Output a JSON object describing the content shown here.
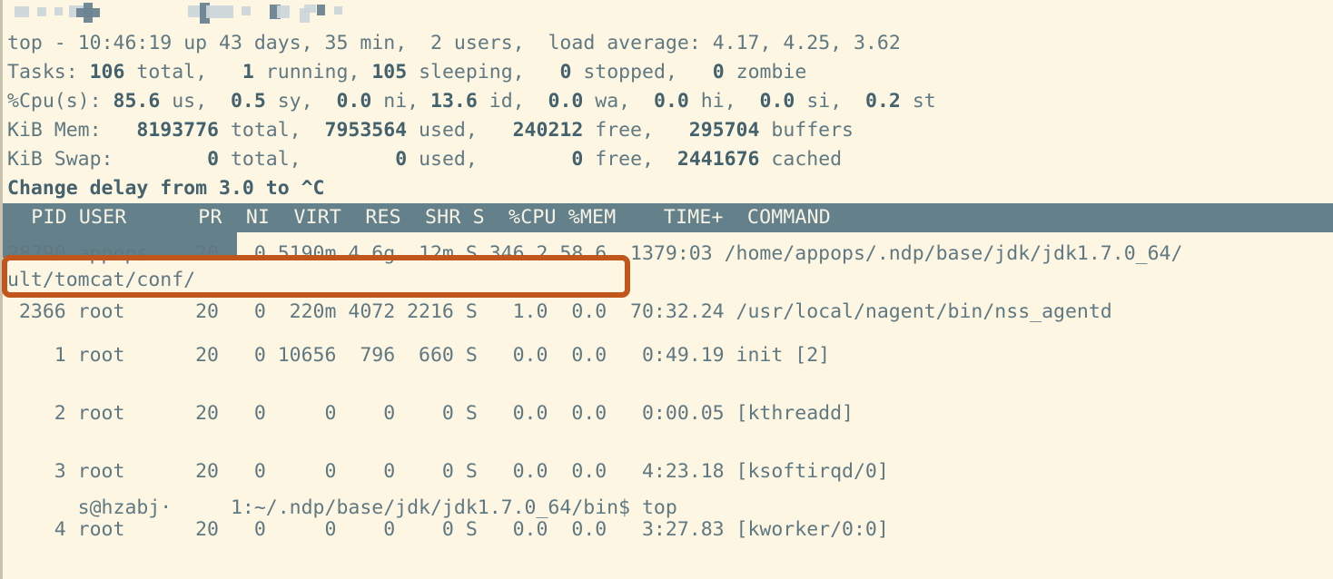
{
  "terminal": {
    "title": "top",
    "colors": {
      "background": "#fdf6e3",
      "foreground": "#5f7882",
      "bold": "#44626e",
      "header_bar_bg": "#64808b",
      "header_bar_fg": "#f7f3e4",
      "highlight_border": "#c0561b"
    }
  },
  "prompt": {
    "user_host_redacted": "s@hzabj·",
    "path_and_command": "1:~/.ndp/base/jdk/jdk1.7.0_64/bin$ top",
    "full_line": "s@hzabj·     1:~/.ndp/base/jdk/jdk1.7.0_64/bin$ top"
  },
  "summary": {
    "uptime_line": "top - 10:46:19 up 43 days, 35 min,  2 users,  load average: 4.17, 4.25, 3.62",
    "uptime": {
      "program": "top",
      "time": "10:46:19",
      "up": "43 days, 35 min",
      "users": "2 users",
      "load_average": "4.17, 4.25, 3.62"
    },
    "tasks_line": "Tasks: 106 total,   1 running, 105 sleeping,   0 stopped,   0 zombie",
    "tasks": {
      "total": "106",
      "running": "1",
      "sleeping": "105",
      "stopped": "0",
      "zombie": "0"
    },
    "cpu_line": "%Cpu(s): 85.6 us,  0.5 sy,  0.0 ni, 13.6 id,  0.0 wa,  0.0 hi,  0.0 si,  0.2 st",
    "cpu": {
      "us": "85.6",
      "sy": "0.5",
      "ni": "0.0",
      "id": "13.6",
      "wa": "0.0",
      "hi": "0.0",
      "si": "0.0",
      "st": "0.2"
    },
    "mem_line": "KiB Mem:   8193776 total,  7953564 used,   240212 free,   295704 buffers",
    "mem": {
      "total": "8193776",
      "used": "7953564",
      "free": "240212",
      "buffers": "295704"
    },
    "swap_line": "KiB Swap:        0 total,        0 used,        0 free,  2441676 cached",
    "swap": {
      "total": "0",
      "used": "0",
      "free": "0",
      "cached": "2441676"
    },
    "message_line": "Change delay from 3.0 to ^C",
    "message": {
      "text": "Change delay from 3.0 to ^C",
      "delay": "3.0",
      "new_value": "^C"
    }
  },
  "table": {
    "header_line": "  PID USER      PR  NI  VIRT  RES  SHR S  %CPU %MEM    TIME+  COMMAND",
    "columns": [
      "PID",
      "USER",
      "PR",
      "NI",
      "VIRT",
      "RES",
      "SHR",
      "S",
      "%CPU",
      "%MEM",
      "TIME+",
      "COMMAND"
    ],
    "rows": [
      {
        "line": "28790 appops    20   0 5190m 4.6g  12m S 346.2 58.6  1379:03 /home/appops/.ndp/base/jdk/jdk1.7.0_64/",
        "pid": "28790",
        "user": "appops",
        "pr": "20",
        "ni": "0",
        "virt": "5190m",
        "res": "4.6g",
        "shr": "12m",
        "s": "S",
        "cpu": "346.2",
        "mem": "58.6",
        "time": "1379:03",
        "command": "/home/appops/.ndp/base/jdk/jdk1.7.0_64/",
        "highlighted": true,
        "wrapped_continuation": "ult/tomcat/conf/"
      },
      {
        "line": " 2366 root      20   0  220m 4072 2216 S   1.0  0.0  70:32.24 /usr/local/nagent/bin/nss_agentd",
        "pid": "2366",
        "user": "root",
        "pr": "20",
        "ni": "0",
        "virt": "220m",
        "res": "4072",
        "shr": "2216",
        "s": "S",
        "cpu": "1.0",
        "mem": "0.0",
        "time": "70:32.24",
        "command": "/usr/local/nagent/bin/nss_agentd",
        "highlighted": false
      },
      {
        "line": "    1 root      20   0 10656  796  660 S   0.0  0.0   0:49.19 init [2]",
        "pid": "1",
        "user": "root",
        "pr": "20",
        "ni": "0",
        "virt": "10656",
        "res": "796",
        "shr": "660",
        "s": "S",
        "cpu": "0.0",
        "mem": "0.0",
        "time": "0:49.19",
        "command": "init [2]",
        "highlighted": false
      },
      {
        "line": "    2 root      20   0     0    0    0 S   0.0  0.0   0:00.05 [kthreadd]",
        "pid": "2",
        "user": "root",
        "pr": "20",
        "ni": "0",
        "virt": "0",
        "res": "0",
        "shr": "0",
        "s": "S",
        "cpu": "0.0",
        "mem": "0.0",
        "time": "0:00.05",
        "command": "[kthreadd]",
        "highlighted": false
      },
      {
        "line": "    3 root      20   0     0    0    0 S   0.0  0.0   4:23.18 [ksoftirqd/0]",
        "pid": "3",
        "user": "root",
        "pr": "20",
        "ni": "0",
        "virt": "0",
        "res": "0",
        "shr": "0",
        "s": "S",
        "cpu": "0.0",
        "mem": "0.0",
        "time": "4:23.18",
        "command": "[ksoftirqd/0]",
        "highlighted": false
      },
      {
        "line": "    4 root      20   0     0    0    0 S   0.0  0.0   3:27.83 [kworker/0:0]",
        "pid": "4",
        "user": "root",
        "pr": "20",
        "ni": "0",
        "virt": "0",
        "res": "0",
        "shr": "0",
        "s": "S",
        "cpu": "0.0",
        "mem": "0.0",
        "time": "3:27.83",
        "command": "[kworker/0:0]",
        "highlighted": false
      }
    ]
  }
}
